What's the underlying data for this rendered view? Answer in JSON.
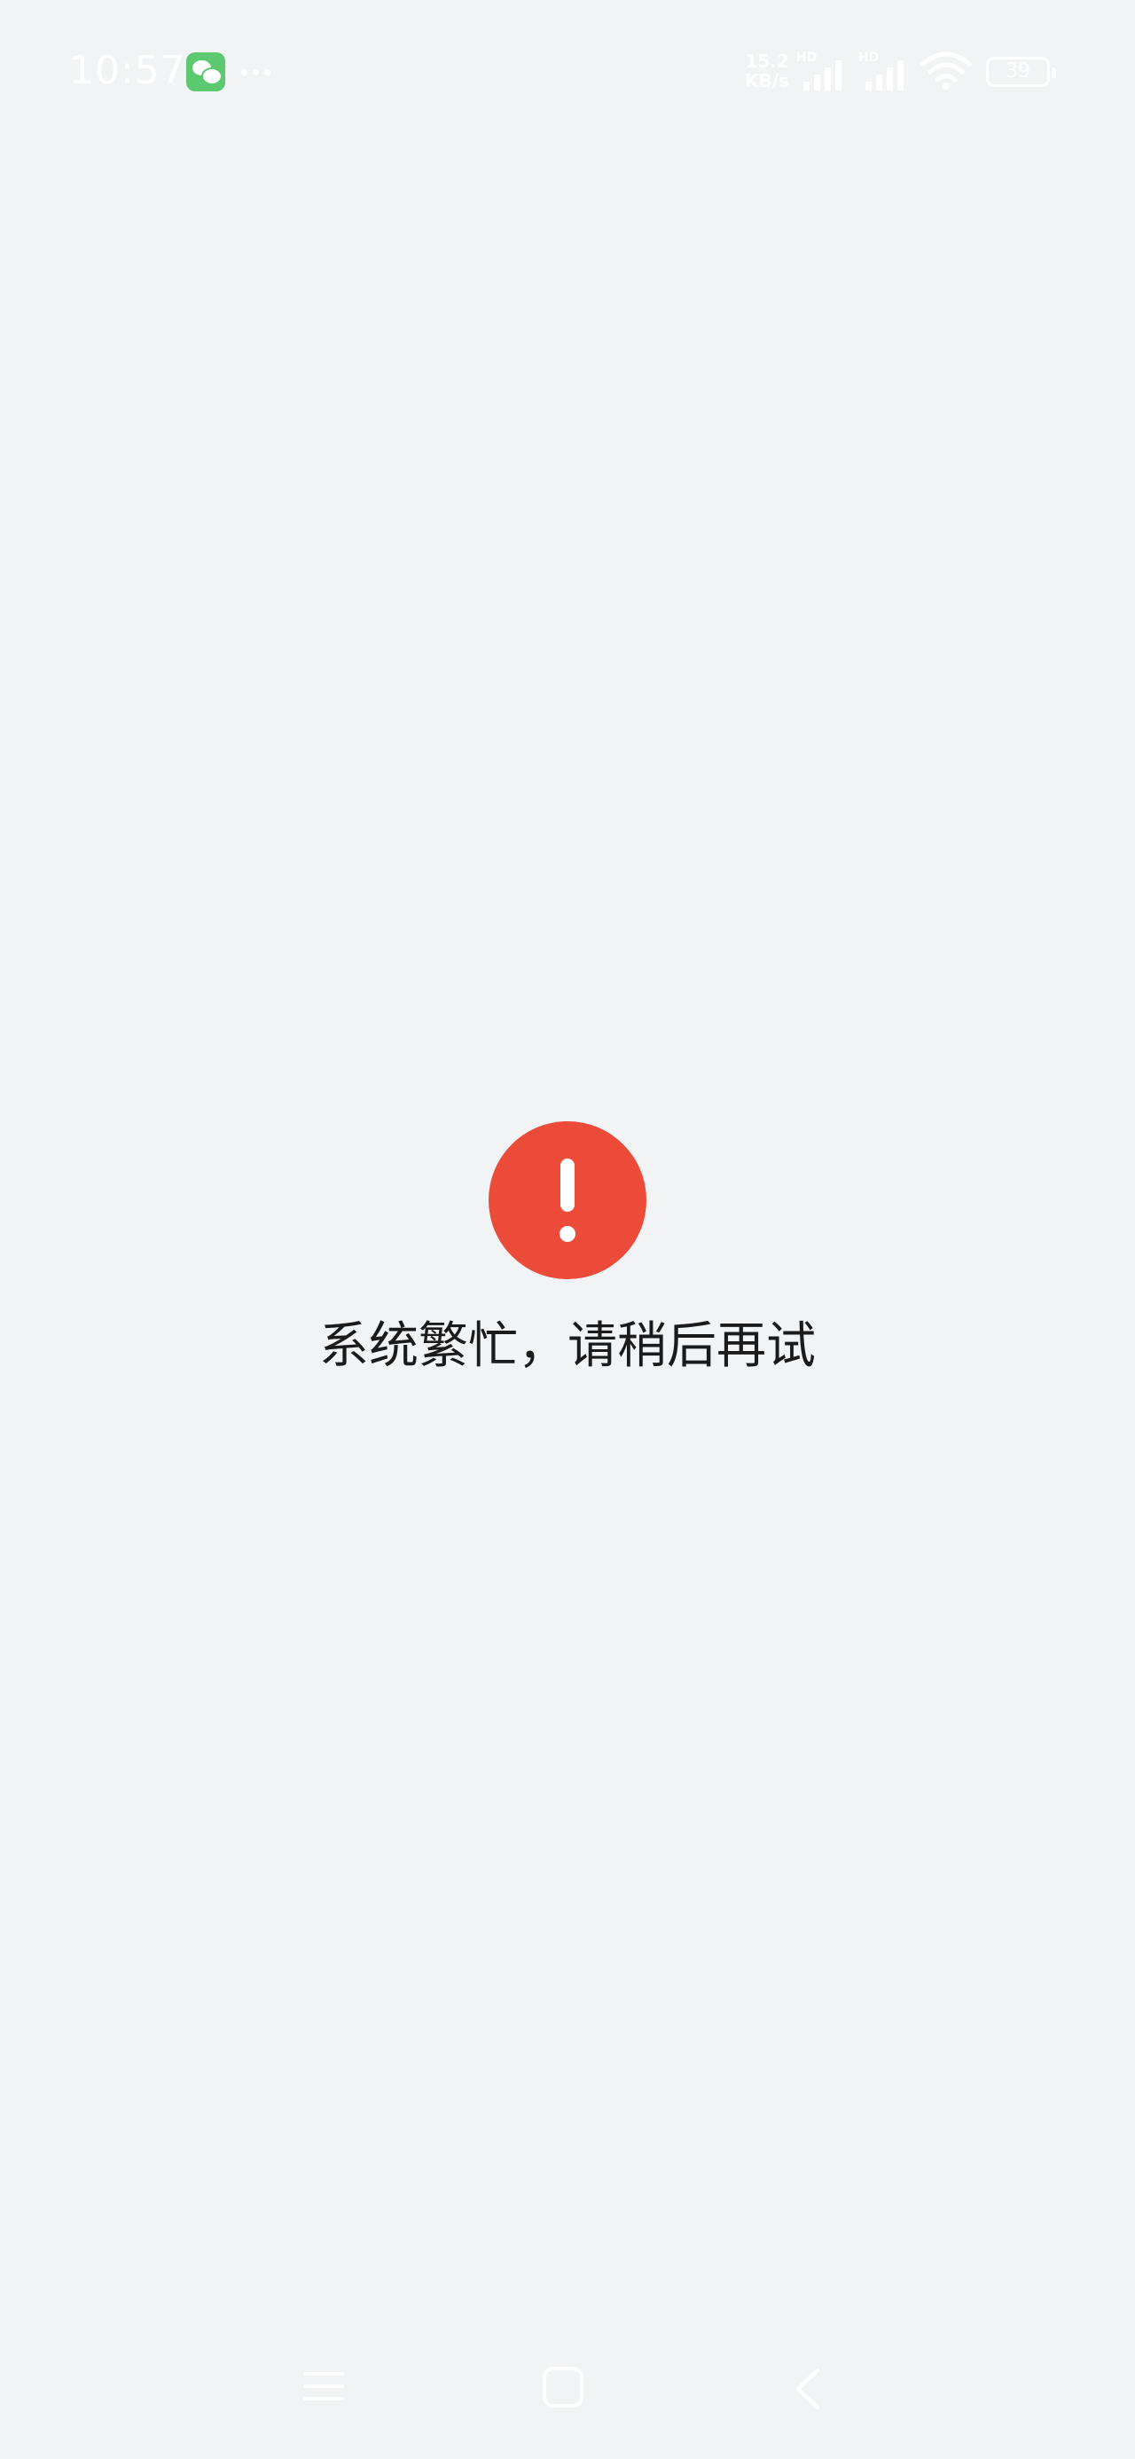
{
  "status_bar": {
    "time": "10:57",
    "notification_icon": "wechat-icon",
    "more_indicator": "···",
    "net_speed_value": "15.2",
    "net_speed_unit": "KB/s",
    "signal_1_label": "HD",
    "signal_2_label": "HD",
    "wifi_icon": "wifi-icon",
    "battery_level": "39"
  },
  "main": {
    "error_icon": "exclamation-icon",
    "message": "系统繁忙，请稍后再试"
  },
  "nav_bar": {
    "menu_icon": "menu-icon",
    "home_icon": "home-icon",
    "back_icon": "back-icon"
  },
  "colors": {
    "background": "#f2f3f5",
    "error_red": "#ec4b3a",
    "wechat_green": "#5cc86f",
    "text": "#1b1b1b"
  }
}
